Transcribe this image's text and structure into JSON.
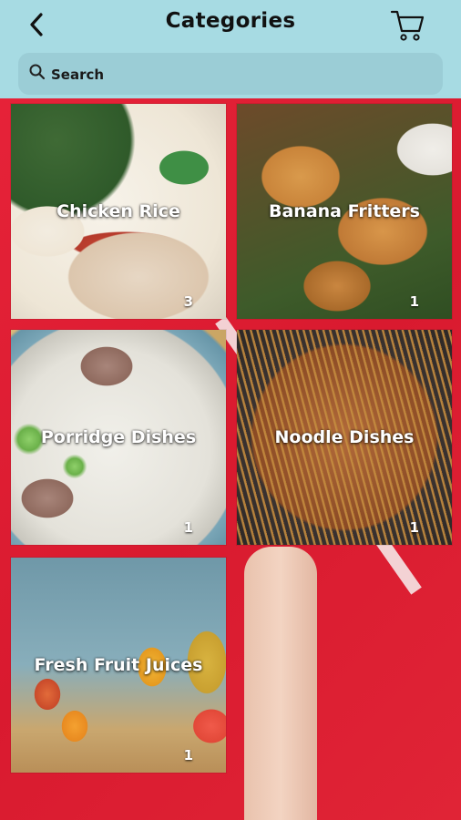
{
  "header": {
    "title": "Categories",
    "back_icon": "chevron-left-icon",
    "cart_icon": "cart-icon"
  },
  "search": {
    "placeholder": "Search",
    "value": "",
    "icon": "search-icon"
  },
  "categories": [
    {
      "name": "Chicken Rice",
      "count": "3"
    },
    {
      "name": "Banana Fritters",
      "count": "1"
    },
    {
      "name": "Porridge Dishes",
      "count": "1"
    },
    {
      "name": "Noodle Dishes",
      "count": "1"
    },
    {
      "name": "Fresh Fruit Juices",
      "count": "1"
    }
  ],
  "colors": {
    "header_bg": "#a7dbe3",
    "search_bg": "#9bcdd6",
    "page_bg": "#e02436"
  }
}
